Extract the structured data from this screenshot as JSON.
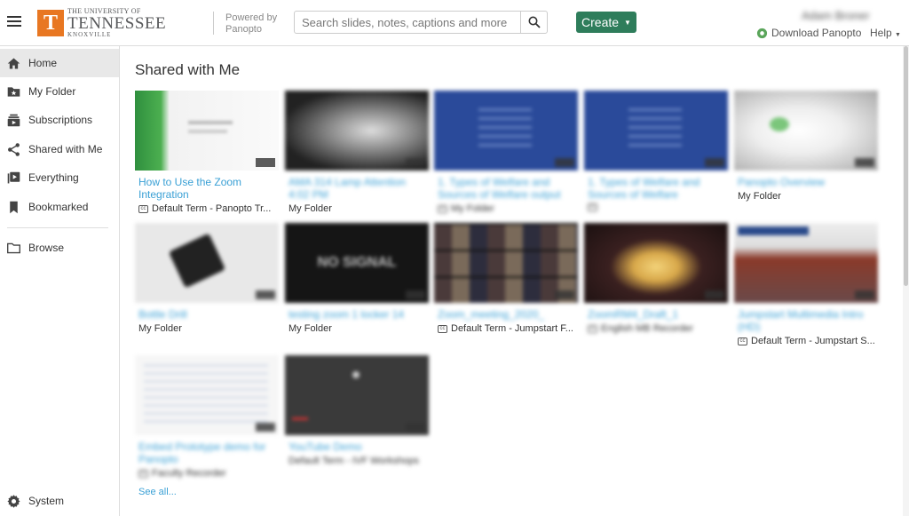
{
  "header": {
    "logo": {
      "line1": "THE UNIVERSITY OF",
      "line2": "TENNESSEE",
      "line3": "KNOXVILLE",
      "mark": "T"
    },
    "powered_by": "Powered by",
    "powered_name": "Panopto",
    "search_placeholder": "Search slides, notes, captions and more",
    "create_label": "Create",
    "user_name": "Adam Broner",
    "download_label": "Download Panopto",
    "help_label": "Help"
  },
  "sidebar": {
    "items": [
      {
        "label": "Home",
        "icon": "home-icon"
      },
      {
        "label": "My Folder",
        "icon": "folder-star-icon"
      },
      {
        "label": "Subscriptions",
        "icon": "subscriptions-icon"
      },
      {
        "label": "Shared with Me",
        "icon": "share-icon"
      },
      {
        "label": "Everything",
        "icon": "playlist-icon"
      },
      {
        "label": "Bookmarked",
        "icon": "bookmark-icon"
      },
      {
        "label": "Browse",
        "icon": "folder-icon"
      },
      {
        "label": "System",
        "icon": "gear-icon"
      }
    ]
  },
  "main": {
    "title": "Shared with Me",
    "see_all": "See all...",
    "cards": [
      {
        "title": "How to Use the Zoom Integration",
        "subtitle": "Default Term - Panopto Tr...",
        "cc": true
      },
      {
        "title": "AMA 314 Lamp Attention 4:02 PM",
        "subtitle": "My Folder",
        "cc": false
      },
      {
        "title": "1. Types of Welfare and Sources of Welfare output",
        "subtitle": "My Folder",
        "cc": true
      },
      {
        "title": "1. Types of Welfare and Sources of Welfare",
        "subtitle": "",
        "cc": true
      },
      {
        "title": "Panopto Overview",
        "subtitle": "My Folder",
        "cc": false
      },
      {
        "title": "Bottle Drill",
        "subtitle": "My Folder",
        "cc": false
      },
      {
        "title": "testing zoom 1 locker 14",
        "subtitle": "My Folder",
        "cc": false
      },
      {
        "title": "Zoom_meeting_2020_",
        "subtitle": "Default Term - Jumpstart F...",
        "cc": true
      },
      {
        "title": "ZoomRM4_Draft_1",
        "subtitle": "English MB Recorder",
        "cc": true
      },
      {
        "title": "Jumpstart Multimedia Intro (HD)",
        "subtitle": "Default Term - Jumpstart S...",
        "cc": true
      },
      {
        "title": "Embed Prototype demo for Panopto",
        "subtitle": "Faculty Recorder",
        "cc": true
      },
      {
        "title": "YouTube Demo",
        "subtitle": "Default Term - IVF Workshops",
        "cc": false
      }
    ]
  },
  "colors": {
    "accent": "#2e7d5b",
    "link": "#3aa0d5",
    "brand_orange": "#e87722"
  }
}
